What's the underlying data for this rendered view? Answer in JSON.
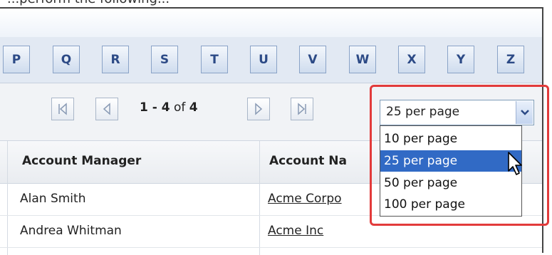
{
  "caption": "...perform the following...",
  "alphabet": [
    "P",
    "Q",
    "R",
    "S",
    "T",
    "U",
    "V",
    "W",
    "X",
    "Y",
    "Z"
  ],
  "pager": {
    "range": "1 - 4",
    "of_label": "of",
    "total": "4",
    "first_icon": "first-page-icon",
    "prev_icon": "previous-page-icon",
    "next_icon": "next-page-icon",
    "last_icon": "last-page-icon"
  },
  "page_size": {
    "selected": "25 per page",
    "options": [
      "10 per page",
      "25 per page",
      "50 per page",
      "100 per page"
    ],
    "highlighted_index": 1,
    "arrow_icon": "chevron-down-icon"
  },
  "table": {
    "columns": [
      "Account Manager",
      "Account Na"
    ],
    "rows": [
      {
        "manager": "Alan Smith",
        "account": "Acme Corpo"
      },
      {
        "manager": "Andrea Whitman",
        "account": "Acme Inc"
      }
    ]
  },
  "colors": {
    "callout_border": "#e23b3b",
    "selected_option": "#316ac5",
    "letter_text": "#2c4a86"
  },
  "cursor_icon": "mouse-pointer-icon"
}
